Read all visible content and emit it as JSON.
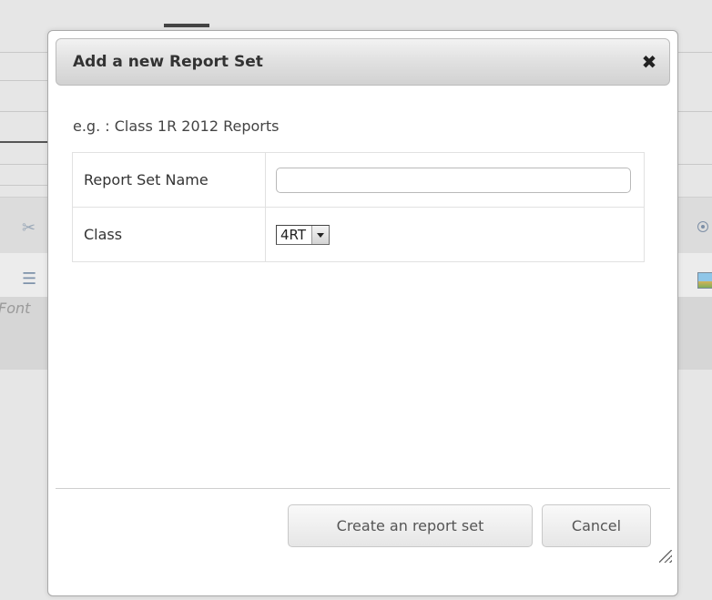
{
  "background": {
    "toolbar_font_label": "Font"
  },
  "dialog": {
    "title": "Add a new Report Set",
    "close_symbol": "✖",
    "example_text": "e.g. : Class 1R 2012 Reports",
    "fields": [
      {
        "label": "Report Set Name",
        "value": "",
        "placeholder": ""
      },
      {
        "label": "Class",
        "selected": "4RT"
      }
    ],
    "buttons": {
      "create_label": "Create an report set",
      "cancel_label": "Cancel"
    }
  },
  "icons": {
    "close": "close-icon",
    "select_arrow": "dropdown-arrow-icon",
    "resize": "resize-grip-icon",
    "scissors": "scissors-icon",
    "list": "bulleted-list-icon",
    "radio": "radio-icon",
    "image": "image-icon"
  },
  "colors": {
    "dialog_bg": "#ffffff",
    "titlebar_top": "#f2f2f2",
    "titlebar_bottom": "#d2d2d2",
    "page_bg": "#e6e6e6"
  }
}
